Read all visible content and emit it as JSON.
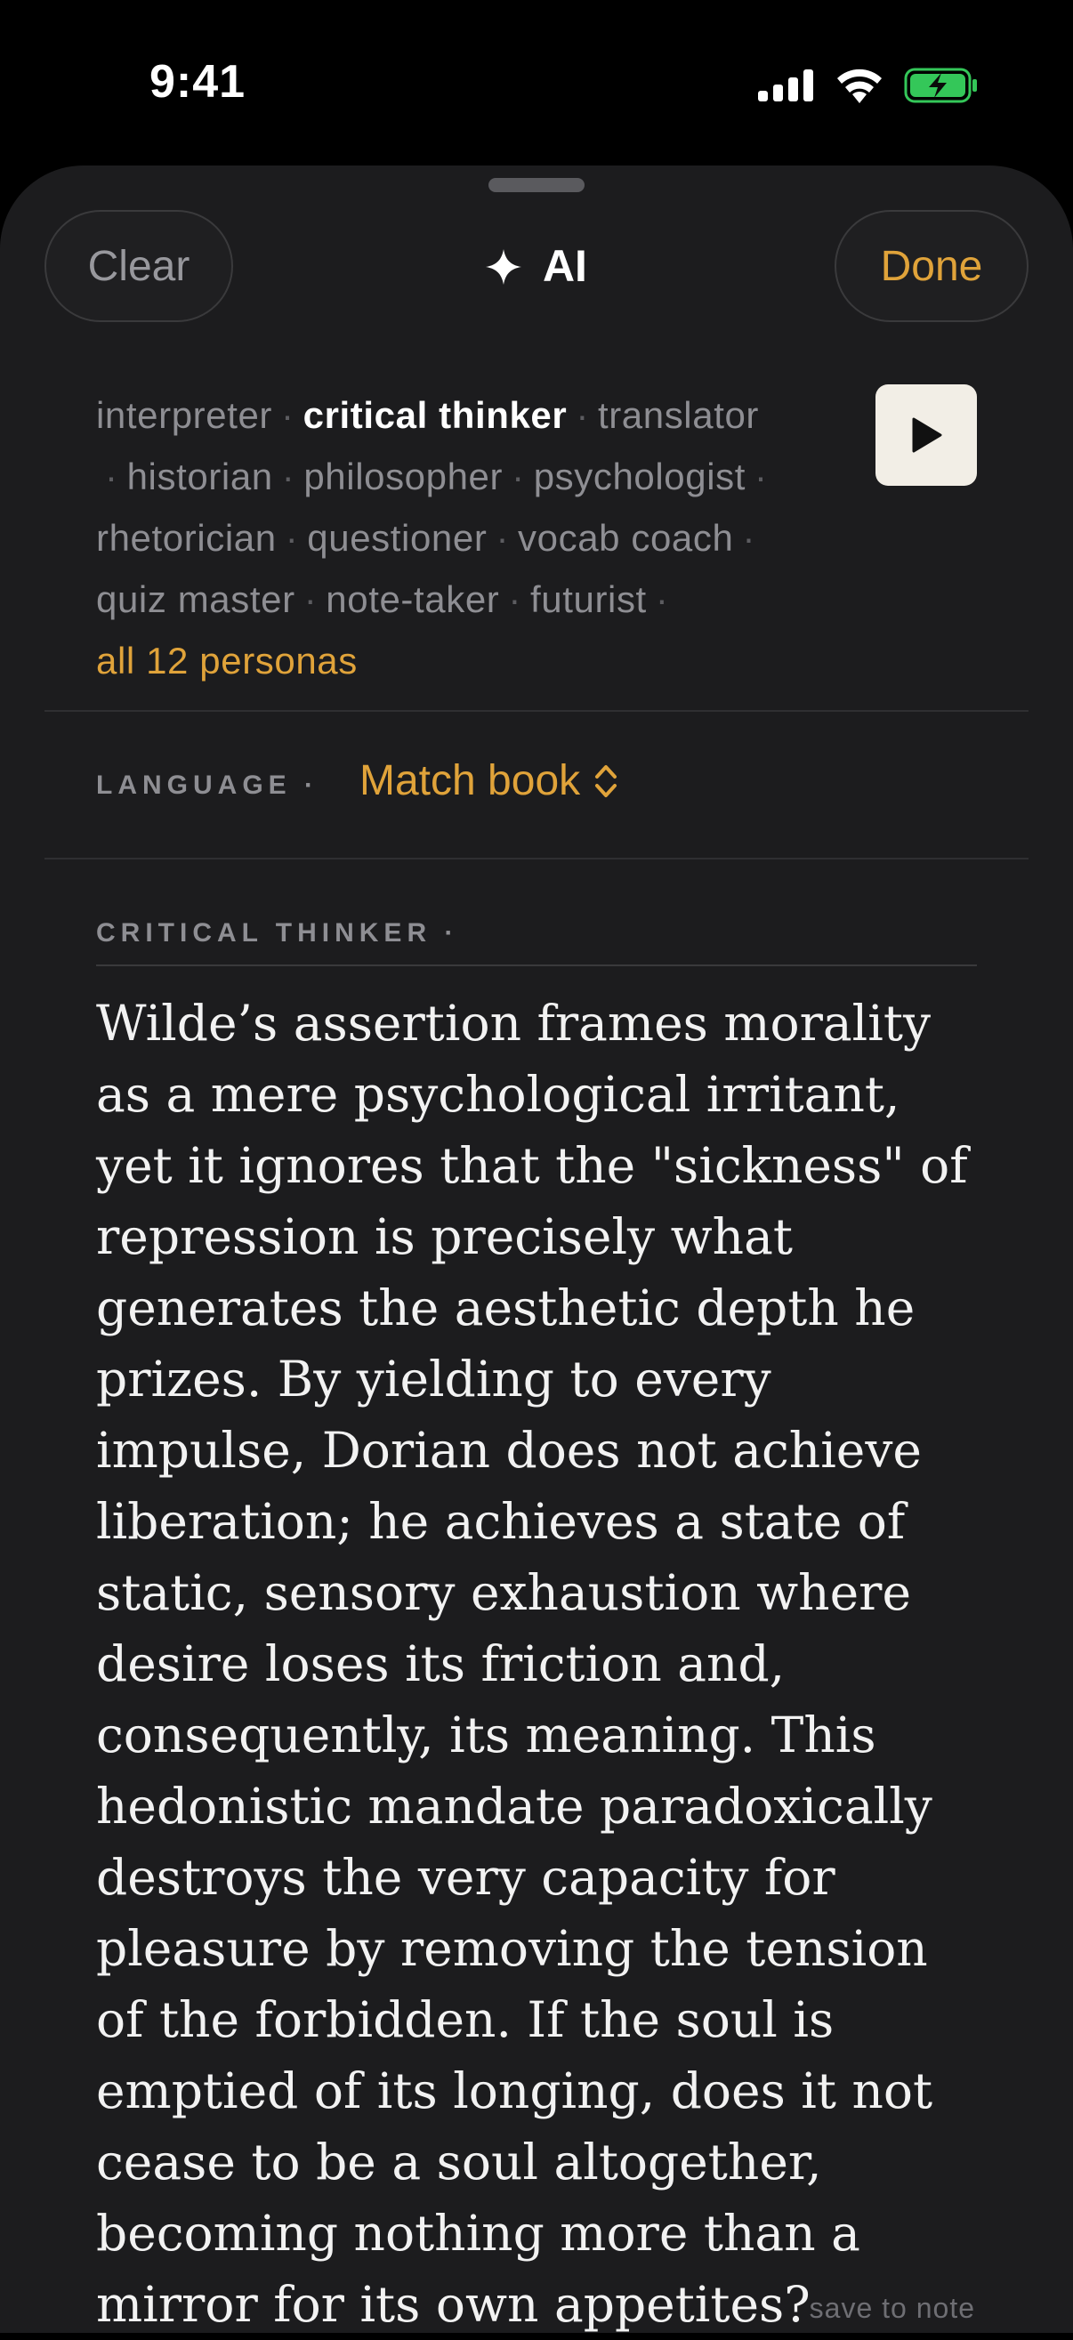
{
  "status": {
    "time": "9:41"
  },
  "header": {
    "clear_label": "Clear",
    "title_icon": "sparkle-icon",
    "title": "AI",
    "done_label": "Done"
  },
  "personas": {
    "items": [
      {
        "label": "interpreter",
        "active": false
      },
      {
        "label": "critical thinker",
        "active": true
      },
      {
        "label": "translator",
        "active": false
      },
      {
        "label": "historian",
        "active": false
      },
      {
        "label": "philosopher",
        "active": false
      },
      {
        "label": "psychologist",
        "active": false
      },
      {
        "label": "rhetorician",
        "active": false
      },
      {
        "label": "questioner",
        "active": false
      },
      {
        "label": "vocab coach",
        "active": false
      },
      {
        "label": "quiz master",
        "active": false
      },
      {
        "label": "note-taker",
        "active": false
      },
      {
        "label": "futurist",
        "active": false
      }
    ],
    "all_link": "all 12 personas",
    "play_icon": "play-icon"
  },
  "language": {
    "label": "LANGUAGE ·",
    "value": "Match book",
    "chevron_icon": "chevron-up-down-icon"
  },
  "content": {
    "label": "CRITICAL THINKER ·",
    "text": "Wilde’s assertion frames morality as a mere psychological irritant, yet it ignores that the \"sickness\" of repression is precisely what generates the aesthetic depth he prizes. By yielding to every impulse, Dorian does not achieve liberation; he achieves a state of static, sensory exhaustion where desire loses its friction and, consequently, its meaning. This hedonistic mandate paradoxically destroys the very capacity for pleasure by removing the tension of the forbidden. If the soul is emptied of its longing, does it not cease to be a soul altogether, becoming nothing more than a mirror for its own appetites?",
    "save_label": "save to note"
  },
  "colors": {
    "accent": "#e0a33a",
    "sheet_bg": "#1c1c1e",
    "battery": "#34c759"
  }
}
